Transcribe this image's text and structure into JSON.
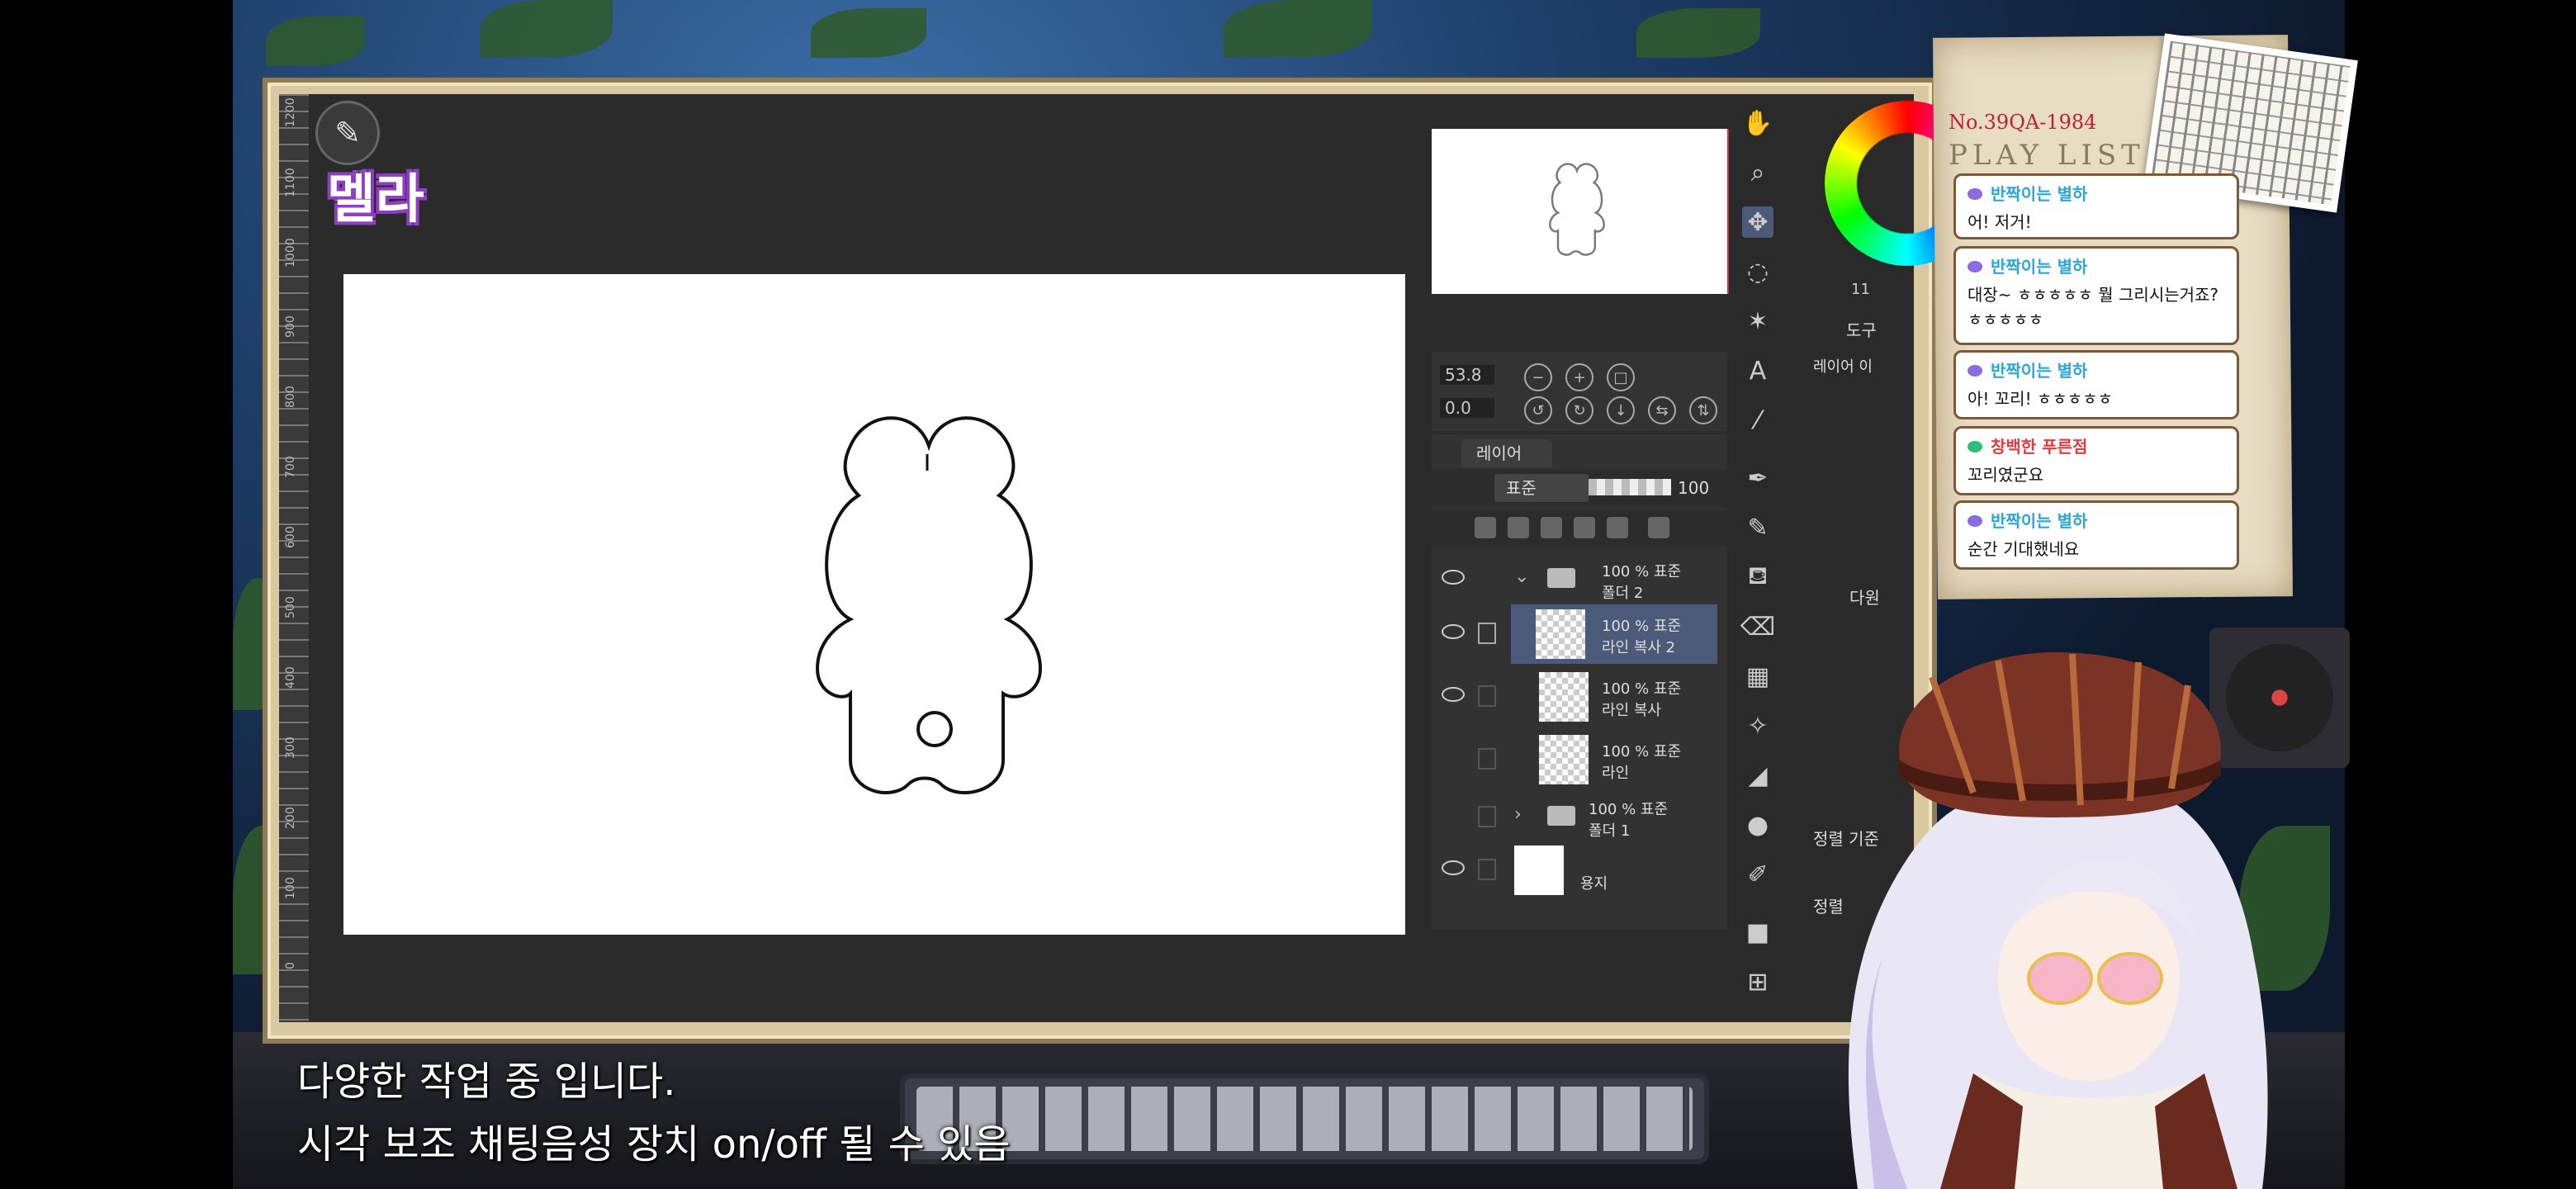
{
  "canvas_app": {
    "ruler_marks": [
      "1200",
      "1100",
      "1000",
      "900",
      "800",
      "700",
      "600",
      "500",
      "400",
      "300",
      "200",
      "100",
      "0"
    ],
    "navigator_zoom": "53.8",
    "navigator_angle": "0.0",
    "layer_tab": "레이어",
    "blend_mode": "표준",
    "opacity": "100",
    "layers": [
      {
        "name": "폴더 2",
        "meta": "100 % 표준",
        "type": "folder",
        "expanded": true
      },
      {
        "name": "라인 복사 2",
        "meta": "100 % 표준",
        "type": "layer",
        "selected": true
      },
      {
        "name": "라인 복사",
        "meta": "100 % 표준",
        "type": "layer"
      },
      {
        "name": "라인",
        "meta": "100 % 표준",
        "type": "layer"
      },
      {
        "name": "폴더 1",
        "meta": "100 % 표준",
        "type": "folder",
        "expanded": false
      },
      {
        "name": "용지",
        "meta": "",
        "type": "paper"
      }
    ],
    "side_labels": {
      "subtool": "도구",
      "layer_move": "레이어 이",
      "next": "다원",
      "sort_base": "정렬 기준",
      "align": "정렬",
      "brush_size": "11"
    }
  },
  "logo_text": "멜라",
  "playlist": {
    "number": "No.39QA-1984",
    "title": "PLAY LIST",
    "messages": [
      {
        "user": "반짝이는 별하",
        "user_color": "#2aa7d8",
        "text": "어! 저거!"
      },
      {
        "user": "반짝이는 별하",
        "user_color": "#2aa7d8",
        "text": "대장~ ㅎㅎㅎㅎㅎ 뭘 그리시는거죠? ㅎㅎㅎㅎㅎ"
      },
      {
        "user": "반짝이는 별하",
        "user_color": "#2aa7d8",
        "text": "아! 꼬리! ㅎㅎㅎㅎㅎ"
      },
      {
        "user": "창백한 푸른점",
        "user_color": "#e03a3a",
        "text": "꼬리였군요"
      },
      {
        "user": "반짝이는 별하",
        "user_color": "#2aa7d8",
        "text": "순간 기대했네요"
      }
    ]
  },
  "subtitles": {
    "line1": "다양한 작업 중 입니다.",
    "line2": "시각 보조 채팅음성 장치 on/off 될 수 있음"
  }
}
